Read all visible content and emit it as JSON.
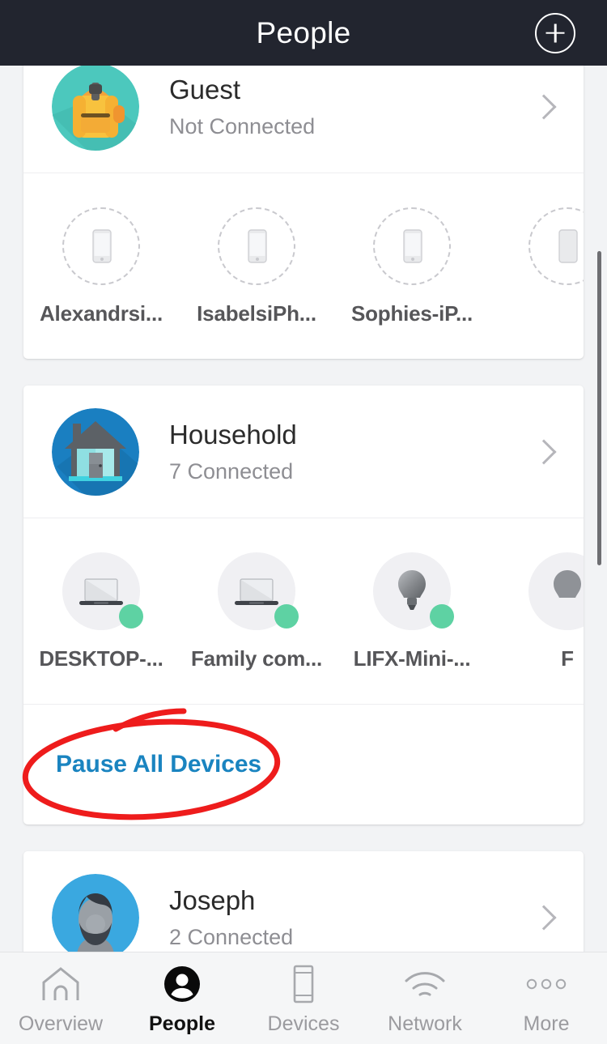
{
  "header": {
    "title": "People",
    "add_icon": "plus-circle-icon"
  },
  "sections": [
    {
      "id": "guest",
      "name": "Guest",
      "status": "Not Connected",
      "avatar_icon": "backpack-avatar-icon",
      "chevron_icon": "chevron-right-icon",
      "devices": [
        {
          "label": "Alexandrsi...",
          "icon": "phone-icon",
          "online": false
        },
        {
          "label": "IsabelsiPh...",
          "icon": "phone-icon",
          "online": false
        },
        {
          "label": "Sophies-iP...",
          "icon": "phone-icon",
          "online": false
        },
        {
          "label": "",
          "icon": "phone-icon",
          "online": false
        }
      ],
      "action": null
    },
    {
      "id": "household",
      "name": "Household",
      "status": "7 Connected",
      "avatar_icon": "house-avatar-icon",
      "chevron_icon": "chevron-right-icon",
      "devices": [
        {
          "label": "DESKTOP-...",
          "icon": "laptop-icon",
          "online": true
        },
        {
          "label": "Family com...",
          "icon": "laptop-icon",
          "online": true
        },
        {
          "label": "LIFX-Mini-...",
          "icon": "lightbulb-icon",
          "online": true
        },
        {
          "label": "F",
          "icon": "lightbulb-icon",
          "online": true
        }
      ],
      "action": "Pause All Devices"
    },
    {
      "id": "joseph",
      "name": "Joseph",
      "status": "2 Connected",
      "avatar_icon": "man-avatar-icon",
      "chevron_icon": "chevron-right-icon",
      "devices": [],
      "action": null
    }
  ],
  "tabbar": {
    "tabs": [
      {
        "label": "Overview",
        "icon": "home-icon",
        "active": false
      },
      {
        "label": "People",
        "icon": "person-icon",
        "active": true
      },
      {
        "label": "Devices",
        "icon": "phone-outline-icon",
        "active": false
      },
      {
        "label": "Network",
        "icon": "wifi-icon",
        "active": false
      },
      {
        "label": "More",
        "icon": "ellipsis-icon",
        "active": false
      }
    ]
  },
  "annotation": {
    "type": "red-ellipse-highlight",
    "target": "Pause All Devices",
    "color": "#ee1c1c"
  },
  "colors": {
    "header_bg": "#22252f",
    "page_bg": "#f2f3f5",
    "card_bg": "#ffffff",
    "accent_link": "#1a84c0",
    "online_badge": "#5ed2a3",
    "annotation_red": "#ee1c1c",
    "tabbar_bg": "#f5f6f7"
  }
}
